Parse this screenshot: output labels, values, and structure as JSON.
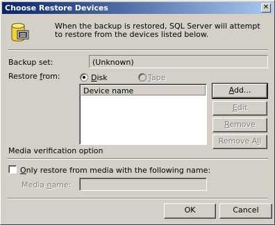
{
  "window": {
    "title": "Choose Restore Devices",
    "close_glyph": "✕"
  },
  "header": {
    "icon": "database-icon",
    "description": "When the backup is restored, SQL Server will attempt to restore from the devices listed below."
  },
  "backup_set": {
    "label": "Backup set:",
    "value": "(Unknown)"
  },
  "restore_from": {
    "label_pre": "Restore ",
    "label_u": "f",
    "label_post": "rom:",
    "disk": {
      "label_u": "D",
      "label_rest": "isk",
      "checked": true
    },
    "tape": {
      "label_u": "T",
      "label_rest": "ape",
      "checked": false,
      "disabled": true
    }
  },
  "device_list": {
    "column_header": "Device name",
    "rows": []
  },
  "buttons": {
    "add": {
      "u": "A",
      "rest": "dd..."
    },
    "edit": {
      "u": "E",
      "rest": "dit"
    },
    "remove": {
      "u": "R",
      "rest": "emove"
    },
    "remove_all": {
      "pre": "Remove A",
      "u": "l",
      "rest": "l"
    },
    "ok": "OK",
    "cancel": "Cancel"
  },
  "media_verification": {
    "section_label": "Media verification option",
    "checkbox": {
      "u": "O",
      "rest": "nly restore from media with the following name:",
      "checked": false
    },
    "media_name": {
      "pre": "Media ",
      "u": "n",
      "rest": "ame:",
      "value": ""
    }
  }
}
